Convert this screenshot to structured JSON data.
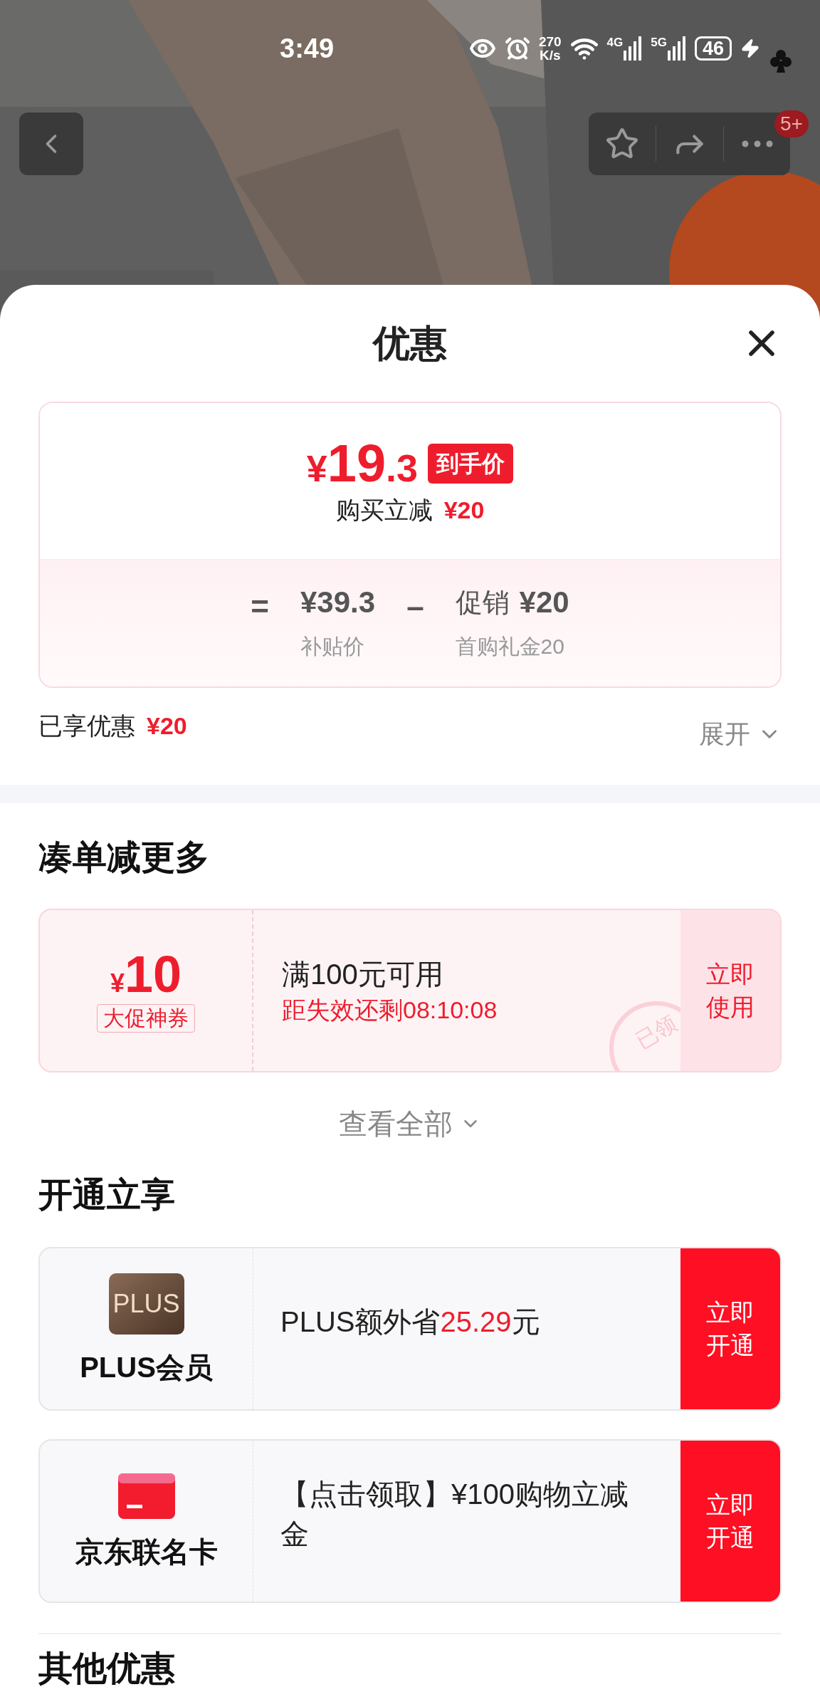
{
  "status_bar": {
    "time": "3:49",
    "net_speed": [
      "270",
      "K/s"
    ],
    "networks": [
      "4G",
      "5G"
    ],
    "battery": "46"
  },
  "nav": {
    "badge": "5+"
  },
  "sheet": {
    "title": "优惠",
    "price_card": {
      "currency": "¥",
      "price_integer": "19",
      "price_decimal": ".3",
      "badge": "到手价",
      "reduction_label": "购买立减",
      "reduction_amount": "¥20",
      "breakdown": [
        {
          "kind": "operator",
          "text": "="
        },
        {
          "kind": "term",
          "value": "¥39.3",
          "caption": "补贴价"
        },
        {
          "kind": "operator",
          "text": "–"
        },
        {
          "kind": "term",
          "label": "促销",
          "value": "¥20",
          "caption": "首购礼金20"
        }
      ]
    },
    "enjoyed": {
      "label": "已享优惠",
      "amount": "¥20",
      "toggle": "展开",
      "expanded": false
    },
    "bundle_section": {
      "title": "凑单减更多",
      "coupons": [
        {
          "currency": "¥",
          "amount": "10",
          "tag": "大促神券",
          "condition": "满100元可用",
          "countdown": "距失效还剩08:10:08",
          "action": "立即使用",
          "claimed": true,
          "stamp": "已领"
        }
      ],
      "view_all": "查看全部"
    },
    "membership_section": {
      "title": "开通立享",
      "offers": [
        {
          "kind": "plus",
          "icon_label": "PLUS",
          "name": "PLUS会员",
          "text_before": "PLUS额外省",
          "highlight": "25.29",
          "text_after": "元",
          "action": "立即开通"
        },
        {
          "kind": "card",
          "name": "京东联名卡",
          "text_before": "【点击领取】¥100购物立减金",
          "action": "立即开通"
        }
      ]
    },
    "other_section": {
      "title": "其他优惠"
    }
  }
}
